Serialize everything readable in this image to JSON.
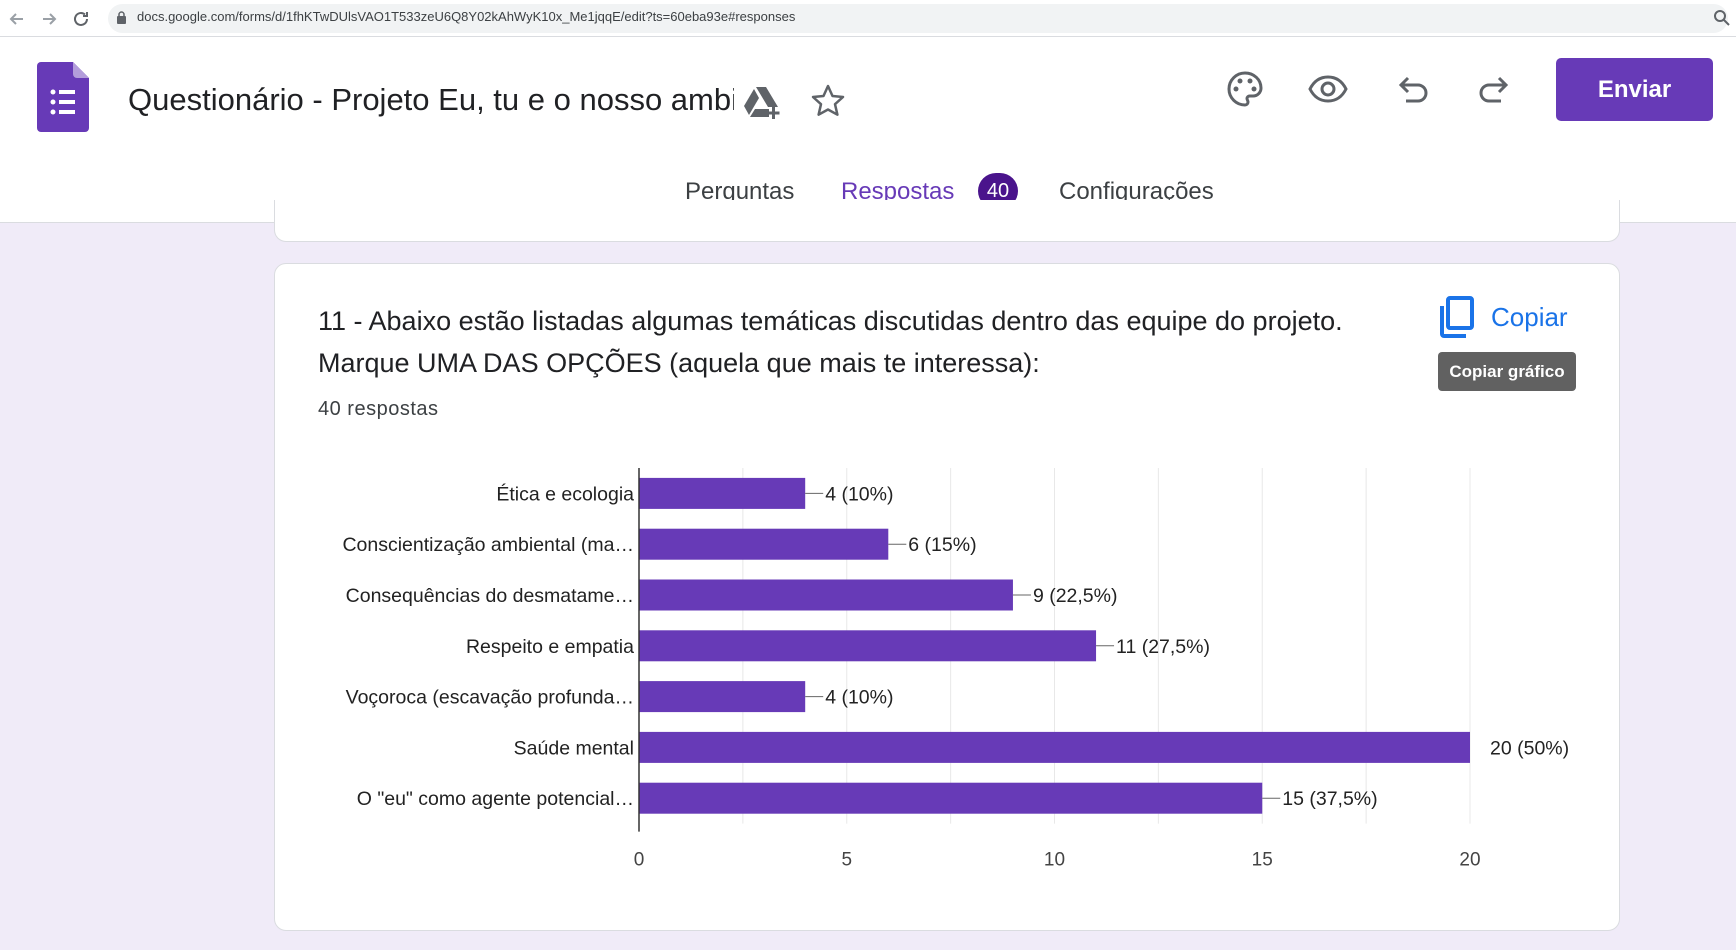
{
  "browser": {
    "url": "docs.google.com/forms/d/1fhKTwDUlsVAO1T533zeU6Q8Y02kAhWyK10x_Me1jqqE/edit?ts=60eba93e#responses",
    "back_icon": "arrow-left-icon",
    "forward_icon": "arrow-right-icon",
    "reload_icon": "reload-icon"
  },
  "header": {
    "title": "Questionário - Projeto Eu, tu e o nosso ambiente",
    "send_label": "Enviar",
    "icons": [
      "palette-icon",
      "eye-icon",
      "undo-icon",
      "redo-icon"
    ]
  },
  "tabs": [
    {
      "label": "Perguntas"
    },
    {
      "label": "Respostas",
      "badge": "40"
    },
    {
      "label": "Configurações"
    }
  ],
  "question": {
    "title": "11 - Abaixo estão listadas algumas temáticas discutidas dentro das equipe do projeto. Marque UMA DAS OPÇÕES (aquela que mais te interessa):",
    "responses": "40 respostas",
    "copy_label": "Copiar",
    "copy_tooltip": "Copiar gráfico"
  },
  "colors": {
    "accent": "#673ab7",
    "bar": "#673ab7",
    "background": "#f0ebf8",
    "link": "#1a73e8"
  },
  "chart_data": {
    "type": "bar",
    "orientation": "horizontal",
    "categories": [
      "Ética e ecologia",
      "Conscientização ambiental (ma…",
      "Consequências do desmatame…",
      "Respeito e empatia",
      "Voçoroca (escavação profunda…",
      "Saúde mental",
      "O \"eu\" como agente potencial…"
    ],
    "values": [
      4,
      6,
      9,
      11,
      4,
      20,
      15
    ],
    "labels": [
      "4 (10%)",
      "6 (15%)",
      "9 (22,5%)",
      "11 (27,5%)",
      "4 (10%)",
      "20 (50%)",
      "15 (37,5%)"
    ],
    "xticks": [
      "0",
      "5",
      "10",
      "15",
      "20"
    ],
    "xlim": [
      0,
      20
    ],
    "grid": true
  }
}
